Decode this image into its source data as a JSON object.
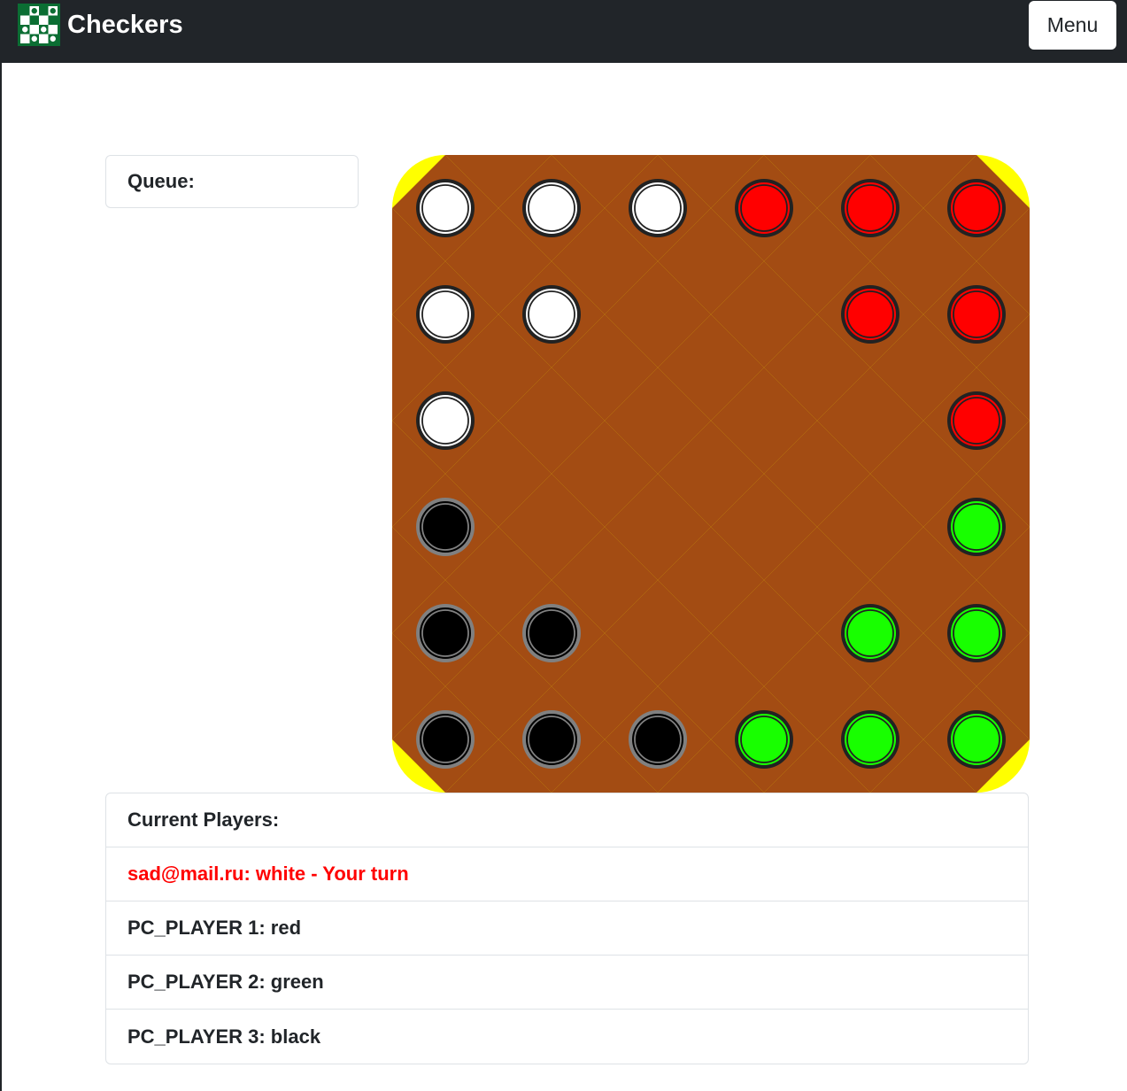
{
  "navbar": {
    "brand_logo_icon": "checkerboard-logo-icon",
    "brand_text": "Checkers",
    "menu_label": "Menu",
    "background": "#212529"
  },
  "queue": {
    "label": "Queue:"
  },
  "board": {
    "rows": 6,
    "cols": 6,
    "colors": {
      "background": "#ffff00",
      "dark_square": "#a34c13",
      "white": "#ffffff",
      "red": "#ff0000",
      "green": "#18ff00",
      "black": "#000000",
      "piece_outline": "#222222",
      "black_piece_outline": "#808080"
    },
    "pieces": [
      {
        "row": 0,
        "col": 0,
        "color": "white"
      },
      {
        "row": 0,
        "col": 1,
        "color": "white"
      },
      {
        "row": 0,
        "col": 2,
        "color": "white"
      },
      {
        "row": 0,
        "col": 3,
        "color": "red"
      },
      {
        "row": 0,
        "col": 4,
        "color": "red"
      },
      {
        "row": 0,
        "col": 5,
        "color": "red"
      },
      {
        "row": 1,
        "col": 0,
        "color": "white"
      },
      {
        "row": 1,
        "col": 1,
        "color": "white"
      },
      {
        "row": 1,
        "col": 4,
        "color": "red"
      },
      {
        "row": 1,
        "col": 5,
        "color": "red"
      },
      {
        "row": 2,
        "col": 0,
        "color": "white"
      },
      {
        "row": 2,
        "col": 5,
        "color": "red"
      },
      {
        "row": 3,
        "col": 0,
        "color": "black"
      },
      {
        "row": 3,
        "col": 5,
        "color": "green"
      },
      {
        "row": 4,
        "col": 0,
        "color": "black"
      },
      {
        "row": 4,
        "col": 1,
        "color": "black"
      },
      {
        "row": 4,
        "col": 4,
        "color": "green"
      },
      {
        "row": 4,
        "col": 5,
        "color": "green"
      },
      {
        "row": 5,
        "col": 0,
        "color": "black"
      },
      {
        "row": 5,
        "col": 1,
        "color": "black"
      },
      {
        "row": 5,
        "col": 2,
        "color": "black"
      },
      {
        "row": 5,
        "col": 3,
        "color": "green"
      },
      {
        "row": 5,
        "col": 4,
        "color": "green"
      },
      {
        "row": 5,
        "col": 5,
        "color": "green"
      }
    ]
  },
  "players": {
    "header": "Current Players:",
    "entries": [
      {
        "text": "sad@mail.ru: white - Your turn",
        "active": true,
        "color": "#ff0000"
      },
      {
        "text": "PC_PLAYER 1: red",
        "active": false
      },
      {
        "text": "PC_PLAYER 2: green",
        "active": false
      },
      {
        "text": "PC_PLAYER 3: black",
        "active": false
      }
    ]
  }
}
